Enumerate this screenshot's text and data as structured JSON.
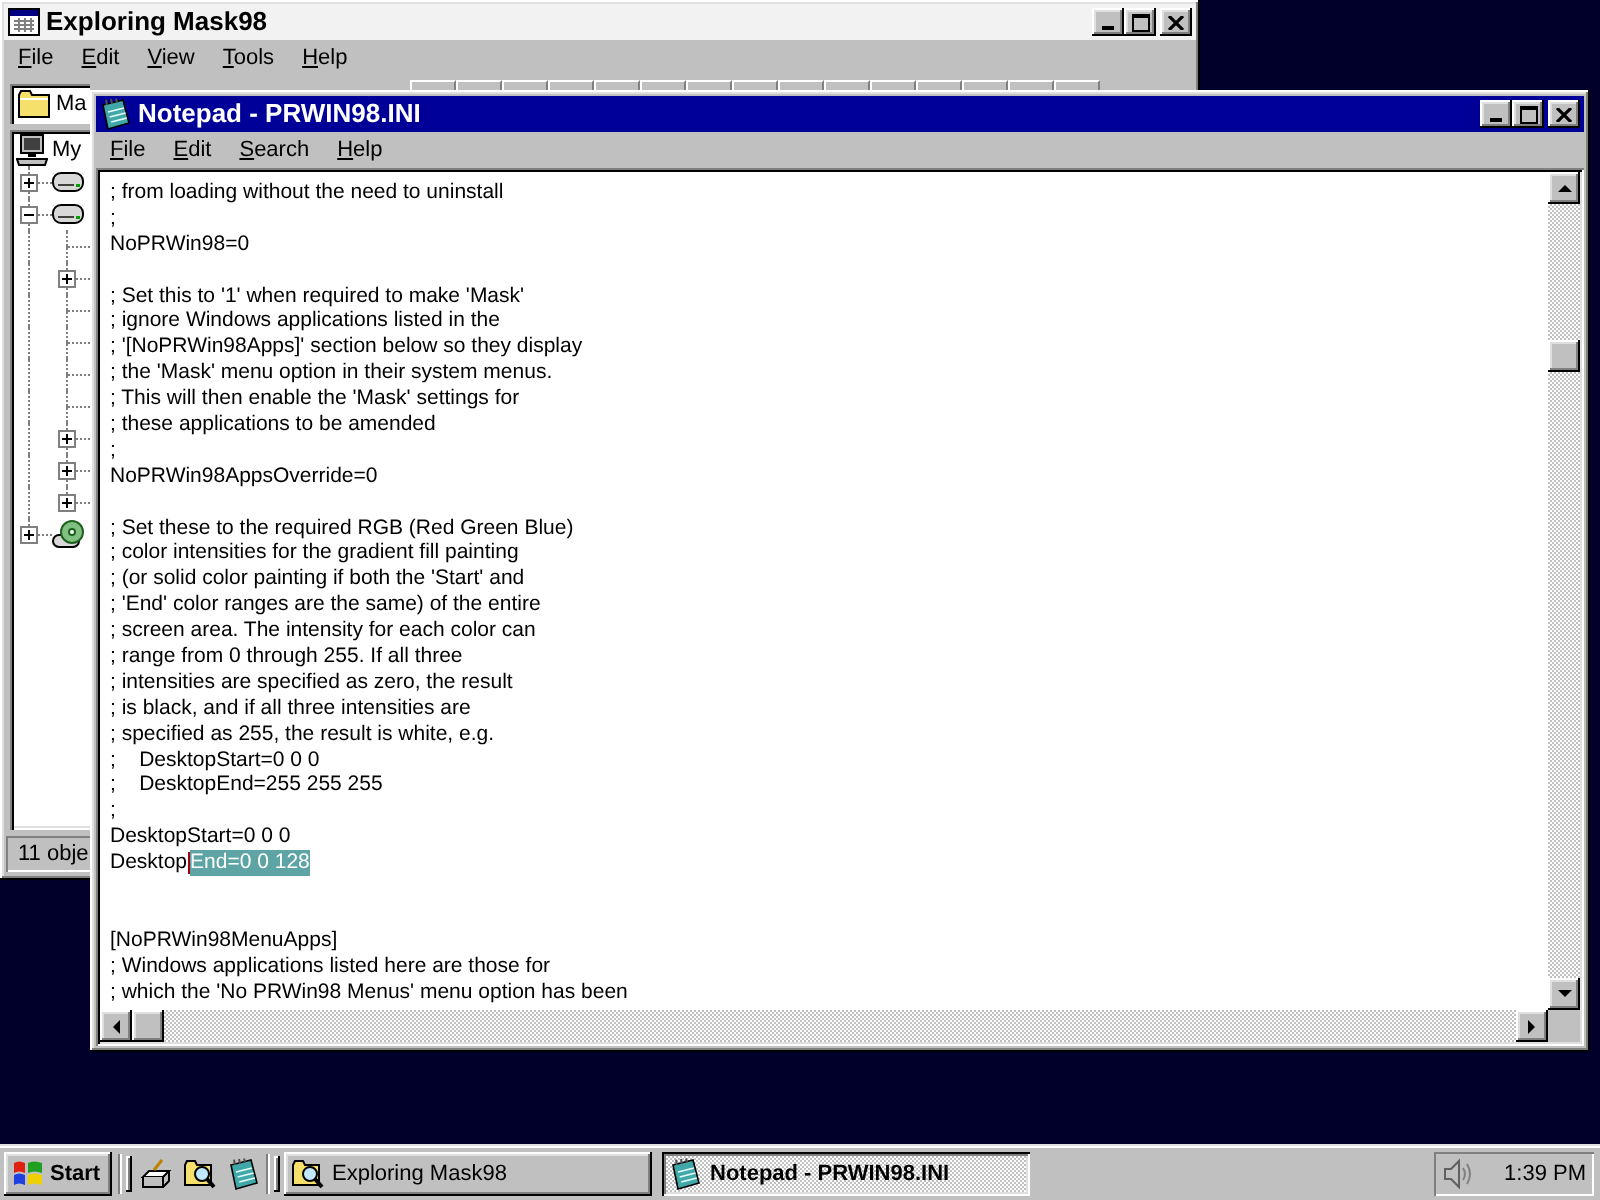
{
  "explorer": {
    "title": "Exploring Mask98",
    "active": false,
    "menu": [
      "File",
      "Edit",
      "View",
      "Tools",
      "Help"
    ],
    "folder_dropdown": "Ma",
    "tree": [
      {
        "kind": "computer",
        "label": "My",
        "children": [
          {
            "kind": "drive",
            "expandable": true,
            "expanded": false
          },
          {
            "kind": "drive",
            "expandable": true,
            "expanded": true,
            "children": [
              {
                "expandable": false
              },
              {
                "expandable": true,
                "expanded": false
              },
              {
                "expandable": false
              },
              {
                "expandable": false
              },
              {
                "expandable": false
              },
              {
                "expandable": false
              },
              {
                "expandable": true,
                "expanded": false
              },
              {
                "expandable": true,
                "expanded": false
              },
              {
                "expandable": true,
                "expanded": false
              }
            ]
          },
          {
            "kind": "cdrom",
            "expandable": true,
            "expanded": false
          }
        ]
      }
    ],
    "status_bar": "11 obje"
  },
  "notepad": {
    "title": "Notepad - PRWIN98.INI",
    "active": true,
    "menu": [
      "File",
      "Edit",
      "Search",
      "Help"
    ],
    "lines": [
      {
        "kind": "text",
        "text": "; from loading without the need to uninstall"
      },
      {
        "kind": "text",
        "text": ";"
      },
      {
        "kind": "text",
        "text": "NoPRWin98=0"
      },
      {
        "kind": "blank"
      },
      {
        "kind": "text",
        "text": "; Set this to '1' when required to make 'Mask'"
      },
      {
        "kind": "text",
        "text": "; ignore Windows applications listed in the"
      },
      {
        "kind": "text",
        "text": "; '[NoPRWin98Apps]' section below so they display"
      },
      {
        "kind": "text",
        "text": "; the 'Mask' menu option in their system menus."
      },
      {
        "kind": "text",
        "text": "; This will then enable the 'Mask' settings for"
      },
      {
        "kind": "text",
        "text": "; these applications to be amended"
      },
      {
        "kind": "text",
        "text": ";"
      },
      {
        "kind": "text",
        "text": "NoPRWin98AppsOverride=0"
      },
      {
        "kind": "blank"
      },
      {
        "kind": "text",
        "text": "; Set these to the required RGB (Red Green Blue)"
      },
      {
        "kind": "text",
        "text": "; color intensities for the gradient fill painting"
      },
      {
        "kind": "text",
        "text": "; (or solid color painting if both the 'Start' and"
      },
      {
        "kind": "text",
        "text": "; 'End' color ranges are the same) of the entire"
      },
      {
        "kind": "text",
        "text": "; screen area. The intensity for each color can"
      },
      {
        "kind": "text",
        "text": "; range from 0 through 255. If all three"
      },
      {
        "kind": "text",
        "text": "; intensities are specified as zero, the result"
      },
      {
        "kind": "text",
        "text": "; is black, and if all three intensities are"
      },
      {
        "kind": "text",
        "text": "; specified as 255, the result is white, e.g."
      },
      {
        "kind": "text",
        "text": ";    DesktopStart=0 0 0"
      },
      {
        "kind": "text",
        "text": ";    DesktopEnd=255 255 255"
      },
      {
        "kind": "text",
        "text": ";"
      },
      {
        "kind": "text",
        "text": "DesktopStart=0 0 0"
      },
      {
        "kind": "selection",
        "segments": [
          {
            "text": "Desktop",
            "selected": false
          },
          {
            "text": "End=0 0 128",
            "selected": true
          }
        ]
      },
      {
        "kind": "blank"
      },
      {
        "kind": "blank"
      },
      {
        "kind": "text",
        "text": "[NoPRWin98MenuApps]"
      },
      {
        "kind": "text",
        "text": "; Windows applications listed here are those for"
      },
      {
        "kind": "text",
        "text": "; which the 'No PRWin98 Menus' menu option has been"
      }
    ]
  },
  "taskbar": {
    "start": "Start",
    "quick_launch": [
      {
        "kind": "desk"
      },
      {
        "kind": "find"
      },
      {
        "kind": "notepad"
      }
    ],
    "tasks": [
      {
        "kind": "explorer",
        "label": "Exploring Mask98",
        "selected": false
      },
      {
        "kind": "notepad",
        "label": "Notepad - PRWIN98.INI",
        "selected": true
      }
    ],
    "clock": "1:39 PM"
  }
}
